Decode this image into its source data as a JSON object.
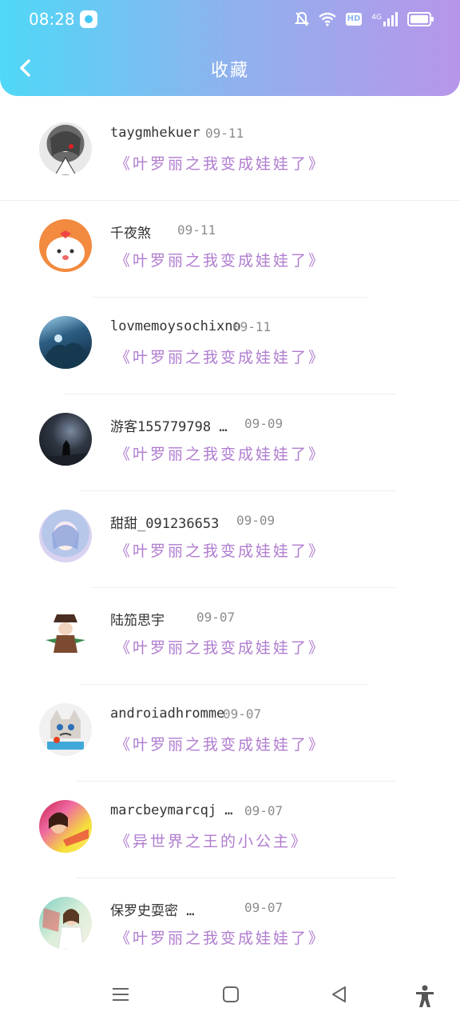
{
  "status": {
    "time": "08:28",
    "hd": "HD",
    "network": "4G"
  },
  "header": {
    "title": "收藏"
  },
  "items": [
    {
      "user": "taygmhekuer",
      "date": "09-11",
      "book": "《叶罗丽之我变成娃娃了》",
      "avatar": "anime-girl-avatar"
    },
    {
      "user": "千夜煞",
      "date": "09-11",
      "book": "《叶罗丽之我变成娃娃了》",
      "avatar": "cartoon-dog-avatar"
    },
    {
      "user": "lovmemoysochixno",
      "date": "09-11",
      "book": "《叶罗丽之我变成娃娃了》",
      "avatar": "game-scene-avatar"
    },
    {
      "user": "游客155779798 …",
      "date": "09-09",
      "book": "《叶罗丽之我变成娃娃了》",
      "avatar": "dark-night-avatar"
    },
    {
      "user": "甜甜_091236653",
      "date": "09-09",
      "book": "《叶罗丽之我变成娃娃了》",
      "avatar": "blue-anime-avatar"
    },
    {
      "user": "陆笳思宇",
      "date": "09-07",
      "book": "《叶罗丽之我变成娃娃了》",
      "avatar": "chibi-character-avatar"
    },
    {
      "user": "androiadhromme",
      "date": "09-07",
      "book": "《叶罗丽之我变成娃娃了》",
      "avatar": "grumpy-cat-avatar"
    },
    {
      "user": "marcbeymarcqj …",
      "date": "09-07",
      "book": "《异世界之王的小公主》",
      "avatar": "colorful-photo-avatar"
    },
    {
      "user": "保罗史耍密 …",
      "date": "09-07",
      "book": "《叶罗丽之我变成娃娃了》",
      "avatar": "girl-photo-avatar"
    }
  ],
  "nav": [
    "menu-icon",
    "home-square-icon",
    "back-triangle-icon",
    "accessibility-icon"
  ]
}
